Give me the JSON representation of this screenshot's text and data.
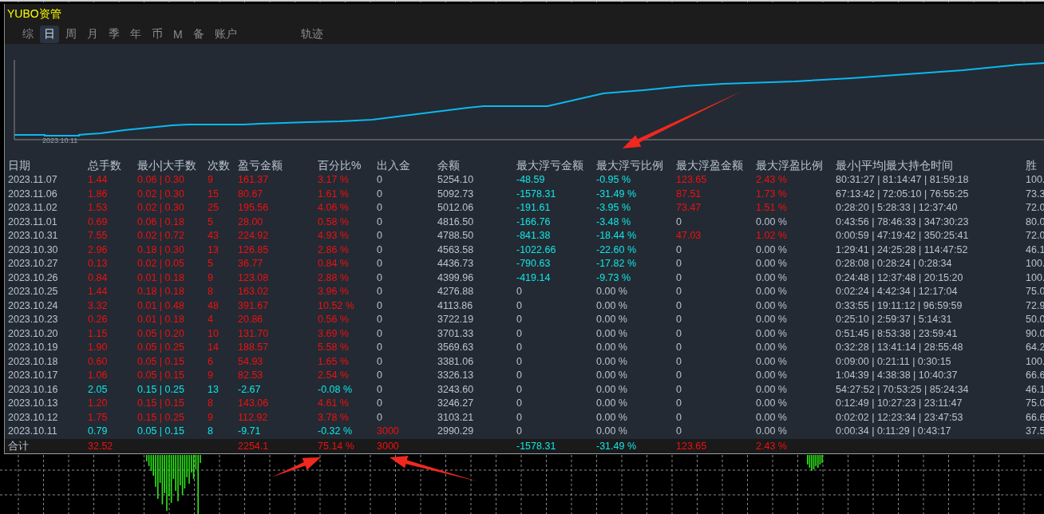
{
  "window": {
    "title": "YUBO资管"
  },
  "tabs": [
    {
      "label": "综",
      "selected": false
    },
    {
      "label": "日",
      "selected": true
    },
    {
      "label": "周",
      "selected": false
    },
    {
      "label": "月",
      "selected": false
    },
    {
      "label": "季",
      "selected": false
    },
    {
      "label": "年",
      "selected": false
    },
    {
      "label": "币",
      "selected": false
    },
    {
      "label": "M",
      "selected": false
    },
    {
      "label": "备",
      "selected": false
    },
    {
      "label": "账户",
      "selected": false
    },
    {
      "label": "轨迹",
      "selected": false
    }
  ],
  "chart": {
    "axis_label": "2023.10.11"
  },
  "table": {
    "columns": [
      "日期",
      "总手数",
      "最小|大手数",
      "次数",
      "盈亏金额",
      "百分比%",
      "出入金",
      "余额",
      "最大浮亏金额",
      "最大浮亏比例",
      "最大浮盈金额",
      "最大浮盈比例",
      "最小|平均|最大持仓时间",
      "胜"
    ],
    "rows": [
      {
        "loss": false,
        "deposit": false,
        "float_loss": true,
        "float_profit": true,
        "cells": [
          "2023.11.07",
          "1.44",
          "0.06 | 0.30",
          "9",
          "161.37",
          "3.17 %",
          "0",
          "5254.10",
          "-48.59",
          "-0.95 %",
          "123.65",
          "2.43 %",
          "80:31:27 | 81:14:47 | 81:59:18",
          "100."
        ]
      },
      {
        "loss": false,
        "deposit": false,
        "float_loss": true,
        "float_profit": true,
        "cells": [
          "2023.11.06",
          "1.86",
          "0.02 | 0.30",
          "15",
          "80.67",
          "1.61 %",
          "0",
          "5092.73",
          "-1578.31",
          "-31.49 %",
          "87.51",
          "1.73 %",
          "67:13:42 | 72:05:10 | 76:55:25",
          "73.3"
        ]
      },
      {
        "loss": false,
        "deposit": false,
        "float_loss": true,
        "float_profit": true,
        "cells": [
          "2023.11.02",
          "1.53",
          "0.02 | 0.30",
          "25",
          "195.56",
          "4.06 %",
          "0",
          "5012.06",
          "-191.61",
          "-3.95 %",
          "73.47",
          "1.51 %",
          "0:28:20 | 5:28:33 | 12:37:40",
          "72.0"
        ]
      },
      {
        "loss": false,
        "deposit": false,
        "float_loss": true,
        "float_profit": false,
        "cells": [
          "2023.11.01",
          "0.69",
          "0.06 | 0.18",
          "5",
          "28.00",
          "0.58 %",
          "0",
          "4816.50",
          "-166.76",
          "-3.48 %",
          "0",
          "0.00 %",
          "0:43:56 | 78:46:33 | 347:30:23",
          "80.0"
        ]
      },
      {
        "loss": false,
        "deposit": false,
        "float_loss": true,
        "float_profit": true,
        "cells": [
          "2023.10.31",
          "7.55",
          "0.02 | 0.72",
          "43",
          "224.92",
          "4.93 %",
          "0",
          "4788.50",
          "-841.38",
          "-18.44 %",
          "47.03",
          "1.02 %",
          "0:00:59 | 47:19:42 | 350:25:41",
          "72.0"
        ]
      },
      {
        "loss": false,
        "deposit": false,
        "float_loss": true,
        "float_profit": false,
        "cells": [
          "2023.10.30",
          "2.96",
          "0.18 | 0.30",
          "13",
          "126.85",
          "2.86 %",
          "0",
          "4563.58",
          "-1022.66",
          "-22.60 %",
          "0",
          "0.00 %",
          "1:29:41 | 24:25:28 | 114:47:52",
          "46.1"
        ]
      },
      {
        "loss": false,
        "deposit": false,
        "float_loss": true,
        "float_profit": false,
        "cells": [
          "2023.10.27",
          "0.13",
          "0.02 | 0.05",
          "5",
          "36.77",
          "0.84 %",
          "0",
          "4436.73",
          "-790.63",
          "-17.82 %",
          "0",
          "0.00 %",
          "0:28:08 | 0:28:24 | 0:28:34",
          "100."
        ]
      },
      {
        "loss": false,
        "deposit": false,
        "float_loss": true,
        "float_profit": false,
        "cells": [
          "2023.10.26",
          "0.84",
          "0.01 | 0.18",
          "9",
          "123.08",
          "2.88 %",
          "0",
          "4399.96",
          "-419.14",
          "-9.73 %",
          "0",
          "0.00 %",
          "0:24:48 | 12:37:48 | 20:15:20",
          "100."
        ]
      },
      {
        "loss": false,
        "deposit": false,
        "float_loss": false,
        "float_profit": false,
        "cells": [
          "2023.10.25",
          "1.44",
          "0.18 | 0.18",
          "8",
          "163.02",
          "3.96 %",
          "0",
          "4276.88",
          "0",
          "0.00 %",
          "0",
          "0.00 %",
          "0:02:24 | 4:42:34 | 12:17:04",
          "75.0"
        ]
      },
      {
        "loss": false,
        "deposit": false,
        "float_loss": false,
        "float_profit": false,
        "cells": [
          "2023.10.24",
          "3.32",
          "0.01 | 0.48",
          "48",
          "391.67",
          "10.52 %",
          "0",
          "4113.86",
          "0",
          "0.00 %",
          "0",
          "0.00 %",
          "0:33:55 | 19:11:12 | 96:59:59",
          "72.9"
        ]
      },
      {
        "loss": false,
        "deposit": false,
        "float_loss": false,
        "float_profit": false,
        "cells": [
          "2023.10.23",
          "0.26",
          "0.01 | 0.18",
          "4",
          "20.86",
          "0.56 %",
          "0",
          "3722.19",
          "0",
          "0.00 %",
          "0",
          "0.00 %",
          "0:25:10 | 2:59:37 | 5:14:31",
          "50.0"
        ]
      },
      {
        "loss": false,
        "deposit": false,
        "float_loss": false,
        "float_profit": false,
        "cells": [
          "2023.10.20",
          "1.15",
          "0.05 | 0.20",
          "10",
          "131.70",
          "3.69 %",
          "0",
          "3701.33",
          "0",
          "0.00 %",
          "0",
          "0.00 %",
          "0:51:45 | 8:53:38 | 23:59:41",
          "90.0"
        ]
      },
      {
        "loss": false,
        "deposit": false,
        "float_loss": false,
        "float_profit": false,
        "cells": [
          "2023.10.19",
          "1.90",
          "0.05 | 0.25",
          "14",
          "188.57",
          "5.58 %",
          "0",
          "3569.63",
          "0",
          "0.00 %",
          "0",
          "0.00 %",
          "0:32:28 | 13:41:14 | 28:55:48",
          "64.2"
        ]
      },
      {
        "loss": false,
        "deposit": false,
        "float_loss": false,
        "float_profit": false,
        "cells": [
          "2023.10.18",
          "0.60",
          "0.05 | 0.15",
          "6",
          "54.93",
          "1.65 %",
          "0",
          "3381.06",
          "0",
          "0.00 %",
          "0",
          "0.00 %",
          "0:09:00 | 0:21:11 | 0:30:15",
          "100."
        ]
      },
      {
        "loss": false,
        "deposit": false,
        "float_loss": false,
        "float_profit": false,
        "cells": [
          "2023.10.17",
          "1.06",
          "0.05 | 0.15",
          "9",
          "82.53",
          "2.54 %",
          "0",
          "3326.13",
          "0",
          "0.00 %",
          "0",
          "0.00 %",
          "1:04:39 | 4:38:38 | 10:40:37",
          "66.6"
        ]
      },
      {
        "loss": true,
        "deposit": false,
        "float_loss": false,
        "float_profit": false,
        "cells": [
          "2023.10.16",
          "2.05",
          "0.15 | 0.25",
          "13",
          "-2.67",
          "-0.08 %",
          "0",
          "3243.60",
          "0",
          "0.00 %",
          "0",
          "0.00 %",
          "54:27:52 | 70:53:25 | 85:24:34",
          "46.1"
        ]
      },
      {
        "loss": false,
        "deposit": false,
        "float_loss": false,
        "float_profit": false,
        "cells": [
          "2023.10.13",
          "1.20",
          "0.15 | 0.15",
          "8",
          "143.06",
          "4.61 %",
          "0",
          "3246.27",
          "0",
          "0.00 %",
          "0",
          "0.00 %",
          "0:12:49 | 10:27:23 | 23:11:47",
          "75.0"
        ]
      },
      {
        "loss": false,
        "deposit": false,
        "float_loss": false,
        "float_profit": false,
        "cells": [
          "2023.10.12",
          "1.75",
          "0.15 | 0.25",
          "9",
          "112.92",
          "3.78 %",
          "0",
          "3103.21",
          "0",
          "0.00 %",
          "0",
          "0.00 %",
          "0:02:02 | 12:23:34 | 23:47:53",
          "66.6"
        ]
      },
      {
        "loss": true,
        "deposit": true,
        "float_loss": false,
        "float_profit": false,
        "cells": [
          "2023.10.11",
          "0.79",
          "0.05 | 0.15",
          "8",
          "-9.71",
          "-0.32 %",
          "3000",
          "2990.29",
          "0",
          "0.00 %",
          "0",
          "0.00 %",
          "0:00:34 | 0:11:29 | 0:43:17",
          "37.5"
        ]
      }
    ],
    "total": {
      "label": "合计",
      "lots": "32.52",
      "profit": "2254.1",
      "percent": "75.14 %",
      "deposit": "3000",
      "max_float_loss": "-1578.31",
      "max_float_loss_pct": "-31.49 %",
      "max_float_profit": "123.65",
      "max_float_profit_pct": "2.43 %"
    }
  }
}
